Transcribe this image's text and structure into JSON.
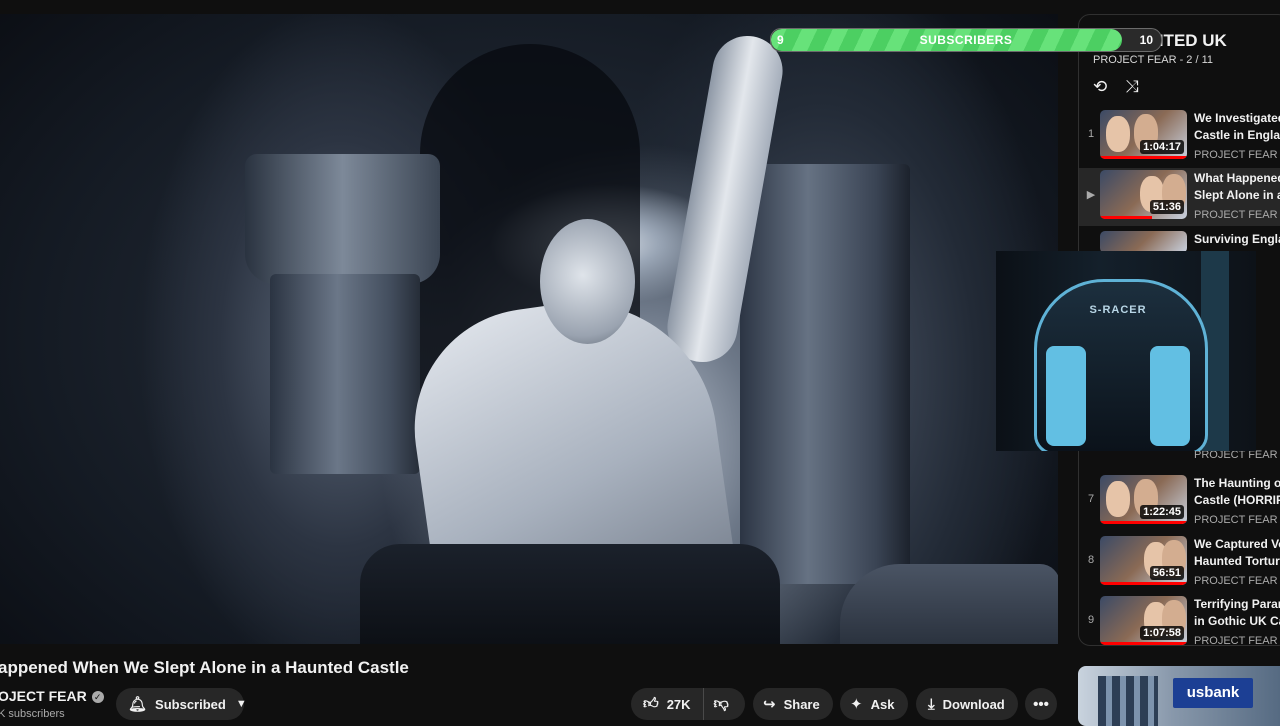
{
  "subscriber_goal": {
    "start": "9",
    "label": "SUBSCRIBERS",
    "end": "10",
    "progress": 0.9
  },
  "playlist": {
    "title": "UNTED UK",
    "subtitle": "PROJECT FEAR - 2 / 11",
    "items": [
      {
        "index": "1",
        "title1": "We Investigated",
        "title2": "Castle in Englan",
        "channel": "PROJECT FEAR",
        "duration": "1:04:17",
        "active": false
      },
      {
        "index": "▶",
        "title1": "What Happened",
        "title2": "Slept Alone in a",
        "channel": "PROJECT FEAR",
        "duration": "51:36",
        "active": true
      },
      {
        "index": "",
        "title1": "Surviving Englan",
        "title2": "",
        "channel": "",
        "duration": "",
        "active": false
      },
      {
        "index": "",
        "title1": "",
        "title2": "",
        "channel": "PROJECT FEAR",
        "duration": "",
        "active": false
      },
      {
        "index": "7",
        "title1": "The Haunting of",
        "title2": "Castle (HORRIFI",
        "channel": "PROJECT FEAR",
        "duration": "1:22:45",
        "active": false
      },
      {
        "index": "8",
        "title1": "We Captured Vo",
        "title2": "Haunted Torture",
        "channel": "PROJECT FEAR",
        "duration": "56:51",
        "active": false
      },
      {
        "index": "9",
        "title1": "Terrifying Paran",
        "title2": "in Gothic UK Ca",
        "channel": "PROJECT FEAR",
        "duration": "1:07:58",
        "active": false
      }
    ]
  },
  "webcam": {
    "chair_brand": "S-RACER"
  },
  "video": {
    "title": "appened When We Slept Alone in a Haunted Castle",
    "channel": "OJECT FEAR",
    "subscribers": "K subscribers"
  },
  "actions": {
    "subscribed": "Subscribed",
    "likes": "27K",
    "share": "Share",
    "ask": "Ask",
    "download": "Download"
  },
  "ad": {
    "logo": "usbank"
  }
}
